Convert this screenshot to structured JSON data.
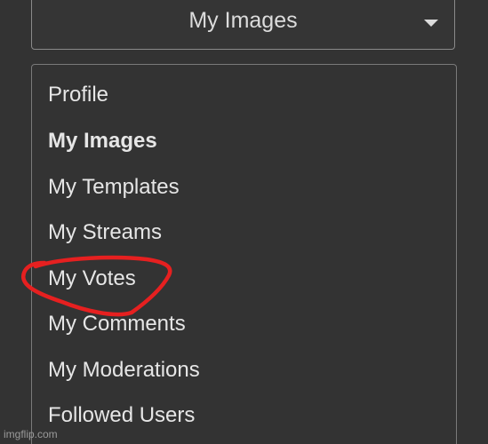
{
  "dropdown": {
    "selected": "My Images"
  },
  "menu": {
    "items": [
      {
        "label": "Profile",
        "active": false
      },
      {
        "label": "My Images",
        "active": true
      },
      {
        "label": "My Templates",
        "active": false
      },
      {
        "label": "My Streams",
        "active": false
      },
      {
        "label": "My Votes",
        "active": false
      },
      {
        "label": "My Comments",
        "active": false
      },
      {
        "label": "My Moderations",
        "active": false
      },
      {
        "label": "Followed Users",
        "active": false
      }
    ]
  },
  "annotation": {
    "color": "#e62020",
    "target": "My Votes"
  },
  "watermark": "imgflip.com",
  "colors": {
    "background": "#333333",
    "text": "#e6e6e6",
    "border": "#7a7a7a"
  }
}
